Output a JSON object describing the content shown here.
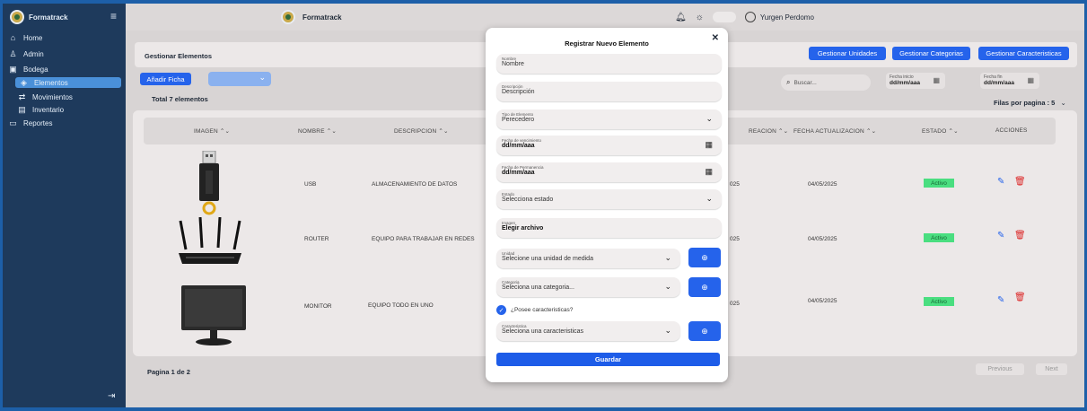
{
  "app": {
    "name": "Formatrack"
  },
  "sidebar": {
    "items": [
      {
        "label": "Home",
        "icon": "home-icon",
        "glyph": "⌂"
      },
      {
        "label": "Admin",
        "icon": "user-icon",
        "glyph": "♙"
      },
      {
        "label": "Bodega",
        "icon": "box-icon",
        "glyph": "▣"
      },
      {
        "label": "Elementos",
        "icon": "cube-icon",
        "glyph": "◈"
      },
      {
        "label": "Movimientos",
        "icon": "arrows-icon",
        "glyph": "⇄"
      },
      {
        "label": "Inventario",
        "icon": "clipboard-icon",
        "glyph": "▤"
      },
      {
        "label": "Reportes",
        "icon": "report-icon",
        "glyph": "▭"
      }
    ]
  },
  "topbar": {
    "brand": "Formatrack",
    "user": "Yurgen Perdomo"
  },
  "main": {
    "title": "Gestionar Elementos",
    "buttons": [
      "Gestionar Unidades",
      "Gestionar Categorias",
      "Gestionar Caracteristicas"
    ],
    "add_button": "Añadir Ficha",
    "total": "Total 7 elementos",
    "search_placeholder": "Buscar...",
    "date_start_label": "Fecha inicio",
    "date_end_label": "Fecha fin",
    "date_placeholder": "dd/mm/aaa",
    "rows_per_page": "Filas por pagina : 5",
    "pager": "Pagina 1 de 2",
    "prev": "Previous",
    "next": "Next"
  },
  "table": {
    "headers": [
      "IMAGEN",
      "NOMBRE",
      "DESCRIPCION",
      "FECHA CREACION",
      "FECHA ACTUALIZACION",
      "ESTADO",
      "ACCIONES"
    ],
    "header_visible": [
      "IMAGEN",
      "NOMBRE",
      "DESCRIPCION",
      "REACION",
      "FECHA ACTUALIZACION",
      "ESTADO",
      "ACCIONES"
    ],
    "rows": [
      {
        "nombre": "USB",
        "descripcion": "ALMACENAMIENTO DE DATOS",
        "creacion": "025",
        "actualizacion": "04/05/2025",
        "estado": "Activo"
      },
      {
        "nombre": "ROUTER",
        "descripcion": "EQUIPO PARA TRABAJAR  EN REDES",
        "creacion": "025",
        "actualizacion": "04/05/2025",
        "estado": "Activo"
      },
      {
        "nombre": "MONITOR",
        "descripcion": "EQUIPO TODO EN UNO",
        "creacion": "025",
        "actualizacion": "04/05/2025",
        "estado": "Activo"
      }
    ]
  },
  "modal": {
    "title": "Registrar Nuevo Elemento",
    "fields": [
      {
        "label": "Nombre",
        "value": "Nombre"
      },
      {
        "label": "Descripción",
        "value": "Descripción"
      },
      {
        "label": "Tipo de Elemento",
        "value": "Perecedero"
      },
      {
        "label": "Fecha de vencimiento",
        "value": "dd/mm/aaa"
      },
      {
        "label": "Fecha de Permanencia",
        "value": "dd/mm/aaa"
      },
      {
        "label": "Estado",
        "value": "Selecciona  estado"
      },
      {
        "label": "Imagen",
        "value": "Elegir archivo"
      },
      {
        "label": "Unidad",
        "value": "Selecione una unidad de medida"
      },
      {
        "label": "Categoria",
        "value": "Seleciona una categoria..."
      },
      {
        "label": "Caracteristica",
        "value": "Seleciona una caracteristicas"
      }
    ],
    "checkbox_label": "¿Posee caracteristicas?",
    "save": "Guardar"
  },
  "colors": {
    "accent": "#2563eb",
    "sidebar": "#1e3a5c",
    "active": "#4ade80"
  }
}
